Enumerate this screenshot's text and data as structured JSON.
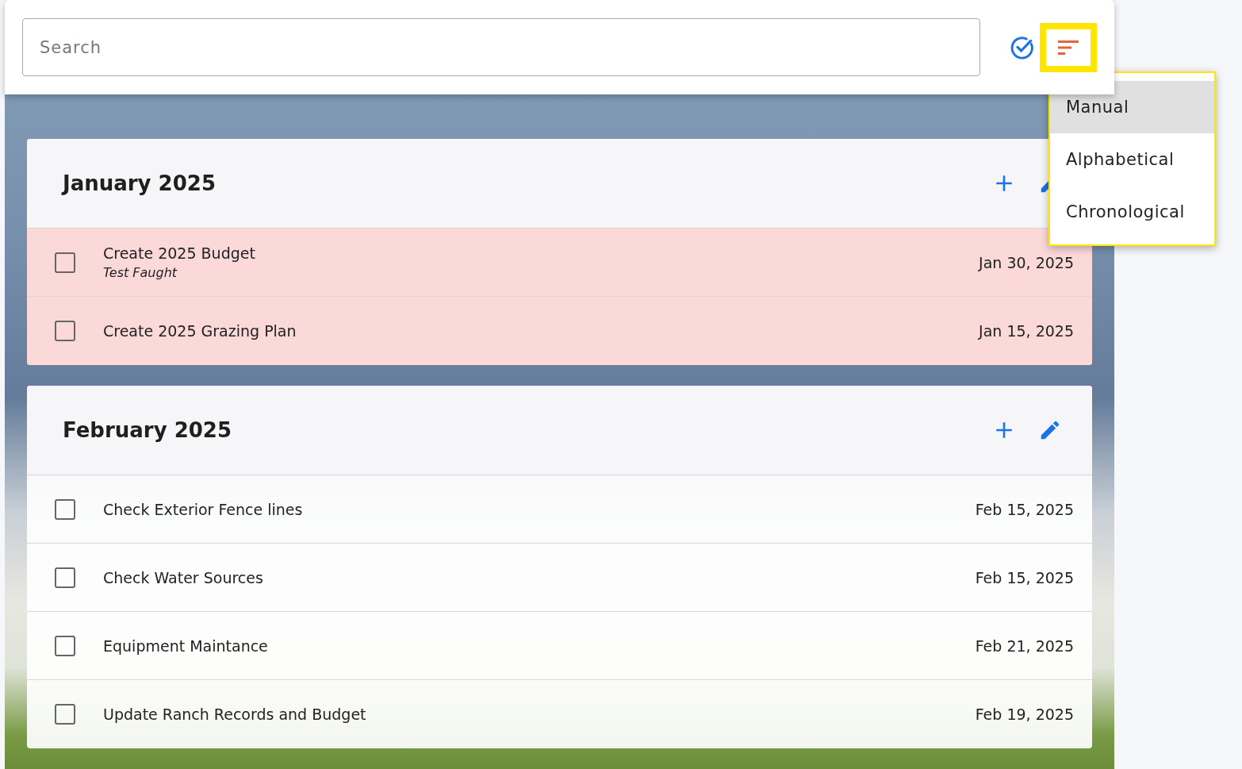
{
  "search": {
    "placeholder": "Search"
  },
  "toolbar": {
    "sort_highlighted": true
  },
  "sort_menu": {
    "highlighted": true,
    "items": [
      {
        "label": "Manual",
        "selected": true
      },
      {
        "label": "Alphabetical",
        "selected": false
      },
      {
        "label": "Chronological",
        "selected": false
      }
    ]
  },
  "groups": [
    {
      "title": "January 2025",
      "tasks": [
        {
          "title": "Create 2025 Budget",
          "note": "Test Faught",
          "due": "Jan 30, 2025",
          "checked": false,
          "overdue": true
        },
        {
          "title": "Create 2025 Grazing Plan",
          "due": "Jan 15, 2025",
          "checked": false,
          "overdue": true
        }
      ]
    },
    {
      "title": "February 2025",
      "tasks": [
        {
          "title": "Check Exterior Fence lines",
          "due": "Feb 15, 2025",
          "checked": false,
          "overdue": false
        },
        {
          "title": "Check Water Sources",
          "due": "Feb 15, 2025",
          "checked": false,
          "overdue": false
        },
        {
          "title": "Equipment Maintance",
          "due": "Feb 21, 2025",
          "checked": false,
          "overdue": false
        },
        {
          "title": "Update Ranch Records and Budget",
          "due": "Feb 19, 2025",
          "checked": false,
          "overdue": false
        }
      ]
    }
  ]
}
